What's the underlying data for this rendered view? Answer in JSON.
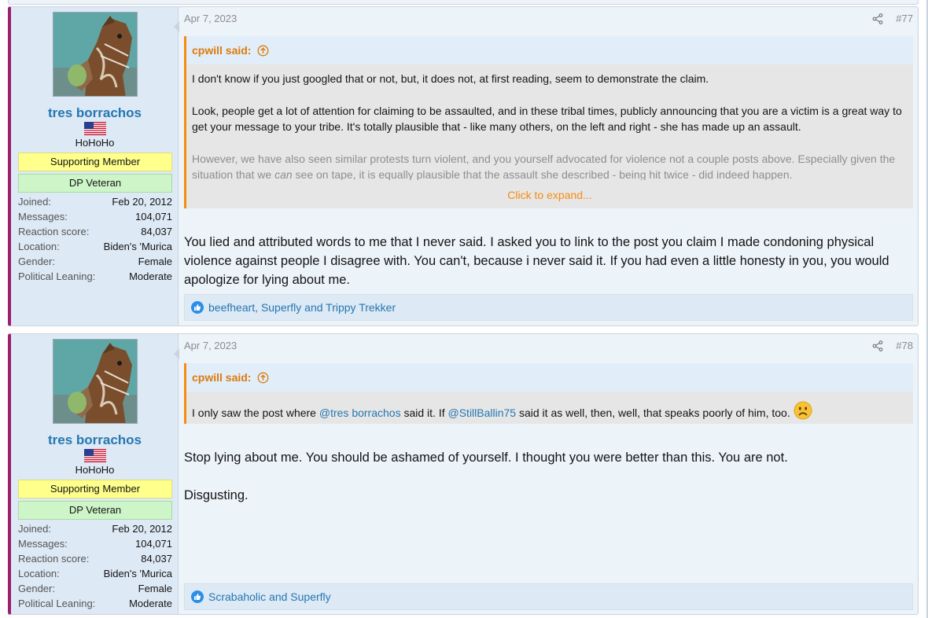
{
  "posts": [
    {
      "user": {
        "name": "tres borrachos",
        "title": "HoHoHo",
        "banners": [
          "Supporting Member",
          "DP Veteran"
        ],
        "stats": [
          {
            "label": "Joined:",
            "value": "Feb 20, 2012"
          },
          {
            "label": "Messages:",
            "value": "104,071"
          },
          {
            "label": "Reaction score:",
            "value": "84,037"
          },
          {
            "label": "Location:",
            "value": "Biden's 'Murica"
          },
          {
            "label": "Gender:",
            "value": "Female"
          },
          {
            "label": "Political Leaning:",
            "value": "Moderate"
          }
        ]
      },
      "date": "Apr 7, 2023",
      "number": "#77",
      "quote": {
        "author": "cpwill said:",
        "p1": "I don't know if you just googled that or not, but, it does not, at first reading, seem to demonstrate the claim.",
        "p2": "Look, people get a lot of attention for claiming to be assaulted, and in these tribal times, publicly announcing that you are a victim is a great way to get your message to your tribe. It's totally plausible that - like many others, on the left and right - she has made up an assault.",
        "p3a": "However, we have also seen similar protests turn violent, and you yourself advocated for violence not a couple posts above. Especially given the situation that we ",
        "p3em": "can",
        "p3b": " see on tape, it is equally plausible that the assault she described - being hit twice - did indeed happen.",
        "expand": "Click to expand..."
      },
      "body": "You lied and attributed words to me that I never said. I asked you to link to the post you claim I made condoning physical violence against people I disagree with. You can't, because i never said it. If you had even a little honesty in you, you would apologize for lying about me.",
      "reactions": "beefheart, Superfly and Trippy Trekker"
    },
    {
      "user": {
        "name": "tres borrachos",
        "title": "HoHoHo",
        "banners": [
          "Supporting Member",
          "DP Veteran"
        ],
        "stats": [
          {
            "label": "Joined:",
            "value": "Feb 20, 2012"
          },
          {
            "label": "Messages:",
            "value": "104,071"
          },
          {
            "label": "Reaction score:",
            "value": "84,037"
          },
          {
            "label": "Location:",
            "value": "Biden's 'Murica"
          },
          {
            "label": "Gender:",
            "value": "Female"
          },
          {
            "label": "Political Leaning:",
            "value": "Moderate"
          }
        ]
      },
      "date": "Apr 7, 2023",
      "number": "#78",
      "quote": {
        "author": "cpwill said:",
        "t1": "I only saw the post where ",
        "m1": "@tres borrachos",
        "t2": " said it. If ",
        "m2": "@StillBallin75",
        "t3": " said it as well, then, well, that speaks poorly of him, too. "
      },
      "body_p1": "Stop lying about me. You should be ashamed of yourself. I thought you were better than this. You are not.",
      "body_p2": "Disgusting.",
      "reactions": "Scrabaholic and Superfly"
    }
  ],
  "icons": {
    "share": "share-icon",
    "quote_jump": "arrow-up-circle-icon",
    "like": "like-icon",
    "flag": "us-flag-icon",
    "emoji": "frown-emoji-icon"
  },
  "colors": {
    "accent": "#2577b1",
    "quote_orange": "#f78c0f",
    "post_stripe": "#9b1f6e",
    "supporting_banner": "#ffff8c",
    "veteran_banner": "#cdf5c8"
  }
}
